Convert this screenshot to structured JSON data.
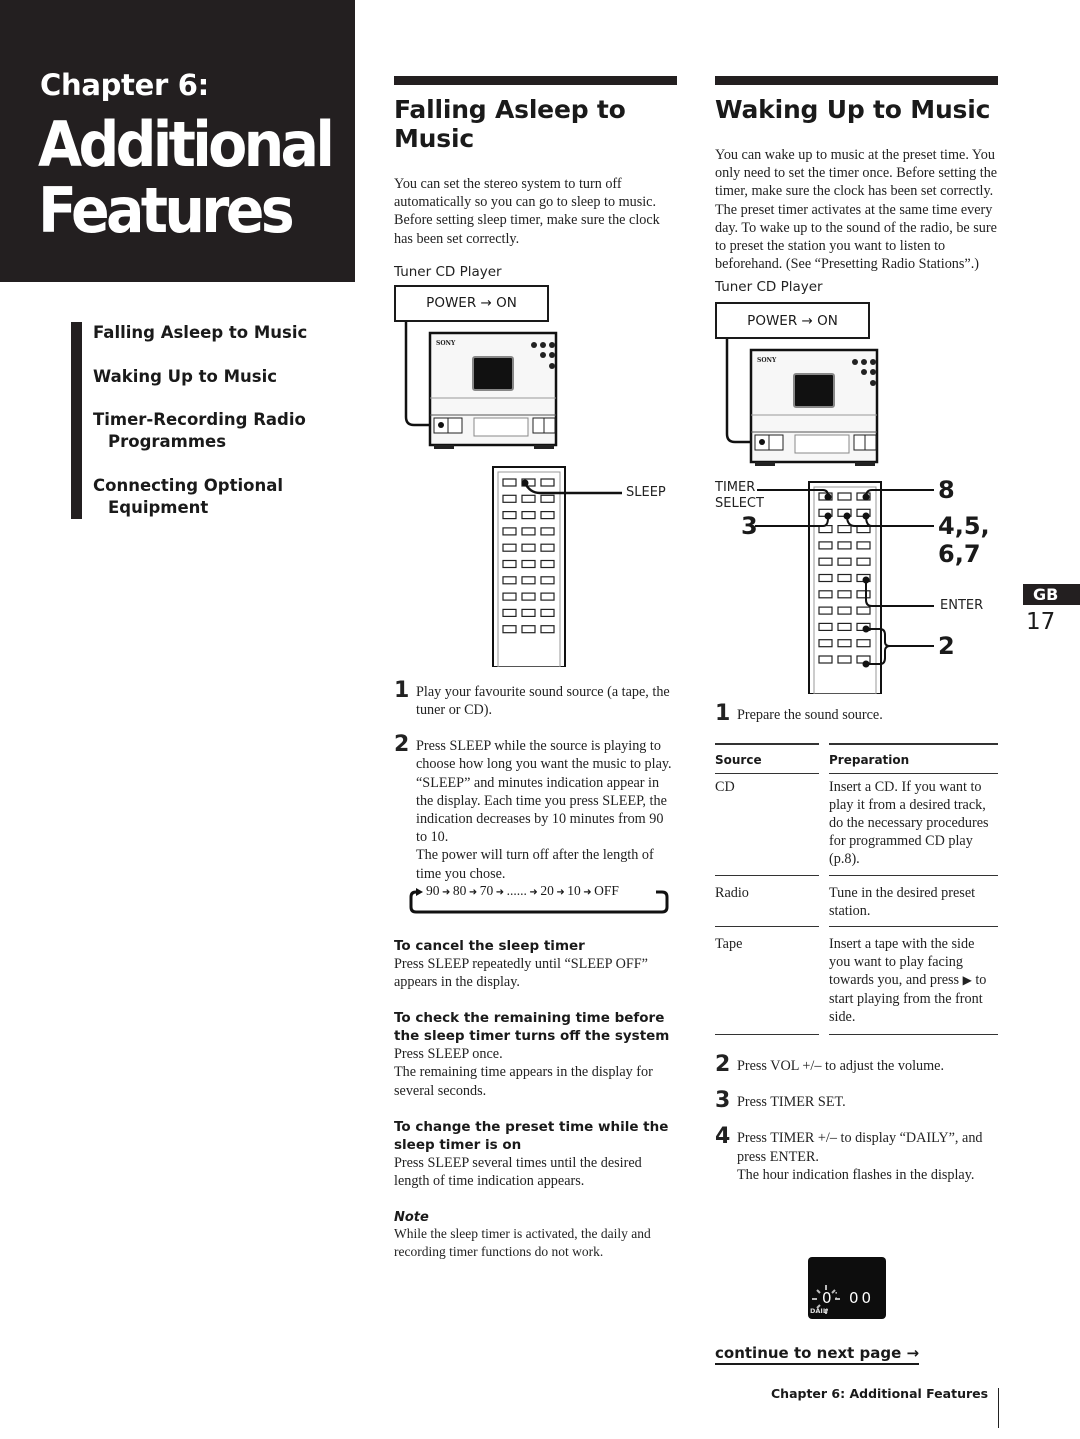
{
  "chapter": {
    "label": "Chapter 6:",
    "title_line1": "Additional",
    "title_line2": "Features"
  },
  "toc": [
    {
      "line1": "Falling Asleep to Music",
      "line2": ""
    },
    {
      "line1": "Waking Up to Music",
      "line2": ""
    },
    {
      "line1": "Timer-Recording Radio",
      "line2": "Programmes"
    },
    {
      "line1": "Connecting Optional",
      "line2": "Equipment"
    }
  ],
  "falling": {
    "title_line1": "Falling Asleep to",
    "title_line2": "Music",
    "intro_p1": "You can set the stereo system to turn off automatically so you can go to sleep to music.",
    "intro_p2": "Before setting sleep timer, make sure the clock has been set correctly.",
    "device_label": "Tuner CD Player",
    "power_label": "POWER → ON",
    "brand": "SONY",
    "remote_callout": "SLEEP",
    "steps": [
      {
        "num": "1",
        "text": "Play your favourite sound source (a tape, the tuner or CD)."
      },
      {
        "num": "2",
        "text": "Press SLEEP while the source is playing to choose how long you want the music to play.",
        "p2": "“SLEEP” and minutes indication appear in the display.  Each time you press SLEEP, the indication decreases by 10 minutes from 90 to 10.",
        "p3": "The power will turn off after the length of time you chose."
      }
    ],
    "cycle": [
      "90",
      "80",
      "70",
      "......",
      "20",
      "10",
      "OFF"
    ],
    "cancel_head": "To cancel the sleep timer",
    "cancel_text": "Press SLEEP repeatedly until “SLEEP OFF” appears in the display.",
    "check_head": "To check the remaining time before the sleep timer turns off the system",
    "check_p1": "Press SLEEP once.",
    "check_p2": "The remaining time appears in the display for several seconds.",
    "change_head": "To change the preset time while the sleep timer is on",
    "change_text": "Press SLEEP several times until the desired length of time indication appears.",
    "note_head": "Note",
    "note_text": "While the sleep timer is activated, the daily and recording timer functions do not work."
  },
  "waking": {
    "title": "Waking Up to Music",
    "intro": "You can wake up to music at the preset time.  You only need to set the timer once.  Before setting the timer, make sure the clock has been set correctly.  The preset timer activates at the same time every day.  To wake up to the sound of the radio, be sure to preset the station you want to listen to beforehand.  (See “Presetting Radio Stations”.)",
    "device_label": "Tuner CD Player",
    "power_label": "POWER → ON",
    "brand": "SONY",
    "callouts": {
      "timer_select_1": "TIMER",
      "timer_select_2": "SELECT",
      "three": "3",
      "eight": "8",
      "four_to_seven_1": "4,5,",
      "four_to_seven_2": "6,7",
      "enter": "ENTER",
      "two": "2"
    },
    "step1": {
      "num": "1",
      "text": "Prepare the sound source."
    },
    "table": {
      "headers": [
        "Source",
        "Preparation"
      ],
      "rows": [
        {
          "source": "CD",
          "prep": "Insert a CD.  If you want to play it from a desired track, do the necessary procedures for programmed CD play (p.8)."
        },
        {
          "source": "Radio",
          "prep": "Tune in the desired preset station."
        },
        {
          "source": "Tape",
          "prep_before": "Insert a tape with the side you want to play facing towards you, and press",
          "prep_icon": "▶",
          "prep_after": "to start playing from the front side."
        }
      ]
    },
    "steps": [
      {
        "num": "2",
        "text": "Press VOL +/– to adjust the volume."
      },
      {
        "num": "3",
        "text": "Press TIMER SET."
      },
      {
        "num": "4",
        "text": "Press TIMER +/– to display “DAILY”, and press ENTER.",
        "p2": "The hour indication flashes in the display."
      }
    ],
    "display": {
      "hour": "0",
      "sep": ":",
      "minutes": "00",
      "indicator": "DAILY"
    }
  },
  "side_tab": {
    "lang": "GB",
    "page": "17"
  },
  "continue_label": "continue to next page →",
  "footer": "Chapter 6: Additional Features"
}
